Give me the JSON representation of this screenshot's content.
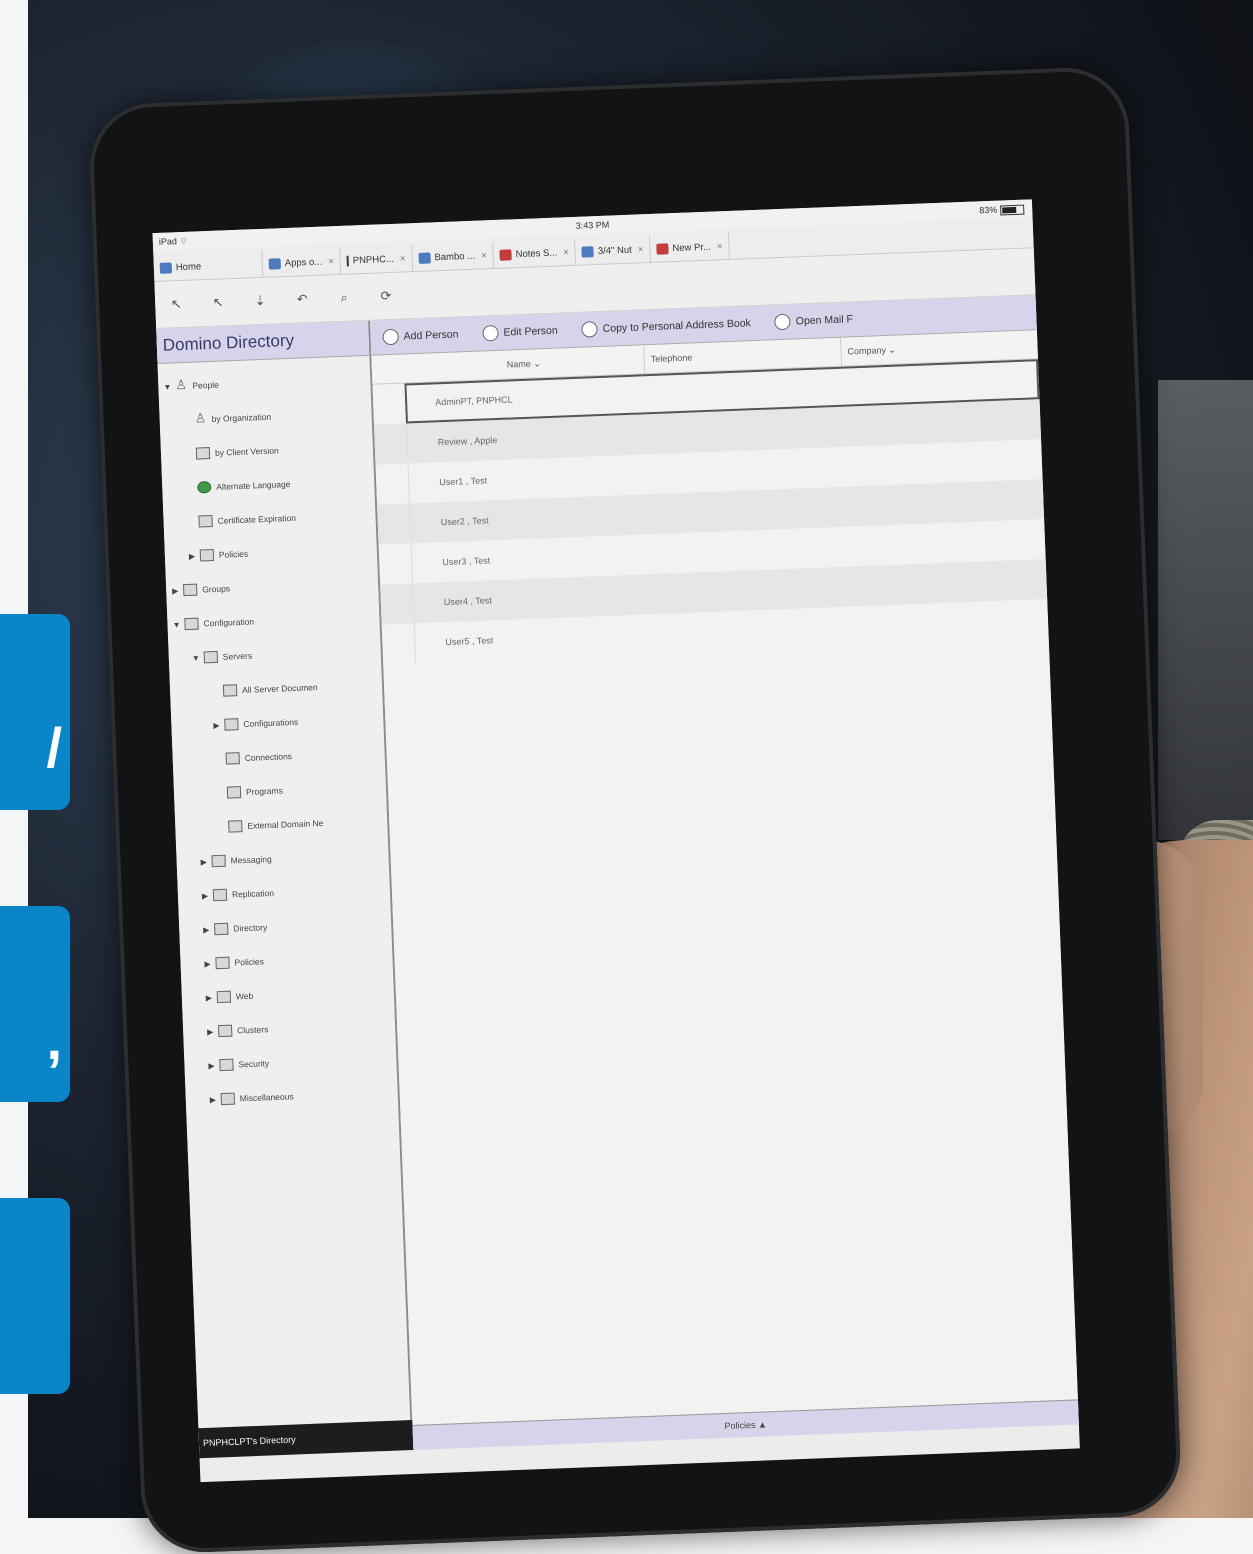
{
  "side_boxes": [
    {
      "glyph": "/"
    },
    {
      "glyph": ","
    },
    {
      "glyph": ""
    }
  ],
  "status_bar": {
    "device": "iPad",
    "wifi_icon": "wifi-icon",
    "time": "3:43 PM",
    "battery": "83%"
  },
  "tabs": [
    {
      "label": "Home",
      "icon": "home-icon",
      "closable": false
    },
    {
      "label": "Apps o...",
      "icon": "db-icon",
      "closable": true
    },
    {
      "label": "PNPHC...",
      "icon": "separator-icon",
      "closable": true
    },
    {
      "label": "Bambo ...",
      "icon": "db-icon",
      "closable": true
    },
    {
      "label": "Notes S...",
      "icon": "notes-icon",
      "closable": true
    },
    {
      "label": "3/4\" Nut",
      "icon": "db-icon",
      "closable": true
    },
    {
      "label": "New Pr...",
      "icon": "notes-icon",
      "closable": true
    }
  ],
  "toolbar": {
    "buttons": [
      "↖",
      "↖",
      "⇣",
      "↶",
      "⌕",
      "⟳"
    ]
  },
  "left_panel": {
    "title": "Domino Directory",
    "items": [
      {
        "label": "People",
        "arrow": "▼",
        "indent": 0,
        "icon": "person"
      },
      {
        "label": "by Organization",
        "arrow": "",
        "indent": 1,
        "icon": "person"
      },
      {
        "label": "by Client Version",
        "arrow": "",
        "indent": 1,
        "icon": "view"
      },
      {
        "label": "Alternate Language",
        "arrow": "",
        "indent": 1,
        "icon": "globe"
      },
      {
        "label": "Certificate Expiration",
        "arrow": "",
        "indent": 1,
        "icon": "view"
      },
      {
        "label": "Policies",
        "arrow": "▶",
        "indent": 1,
        "icon": "view"
      },
      {
        "label": "Groups",
        "arrow": "▶",
        "indent": 0,
        "icon": "view"
      },
      {
        "label": "Configuration",
        "arrow": "▼",
        "indent": 0,
        "icon": "view"
      },
      {
        "label": "Servers",
        "arrow": "▼",
        "indent": 1,
        "icon": "view"
      },
      {
        "label": "All Server Documen",
        "arrow": "",
        "indent": 2,
        "icon": "view"
      },
      {
        "label": "Configurations",
        "arrow": "▶",
        "indent": 2,
        "icon": "view"
      },
      {
        "label": "Connections",
        "arrow": "",
        "indent": 2,
        "icon": "view"
      },
      {
        "label": "Programs",
        "arrow": "",
        "indent": 2,
        "icon": "view"
      },
      {
        "label": "External Domain Ne",
        "arrow": "",
        "indent": 2,
        "icon": "view"
      },
      {
        "label": "Messaging",
        "arrow": "▶",
        "indent": 1,
        "icon": "view"
      },
      {
        "label": "Replication",
        "arrow": "▶",
        "indent": 1,
        "icon": "view"
      },
      {
        "label": "Directory",
        "arrow": "▶",
        "indent": 1,
        "icon": "view"
      },
      {
        "label": "Policies",
        "arrow": "▶",
        "indent": 1,
        "icon": "view"
      },
      {
        "label": "Web",
        "arrow": "▶",
        "indent": 1,
        "icon": "view"
      },
      {
        "label": "Clusters",
        "arrow": "▶",
        "indent": 1,
        "icon": "view"
      },
      {
        "label": "Security",
        "arrow": "▶",
        "indent": 1,
        "icon": "view"
      },
      {
        "label": "Miscellaneous",
        "arrow": "▶",
        "indent": 1,
        "icon": "view"
      }
    ],
    "footer": "PNPHCLPT's Directory"
  },
  "actions": [
    {
      "label": "Add Person",
      "icon": "add-icon"
    },
    {
      "label": "Edit Person",
      "icon": "edit-icon"
    },
    {
      "label": "Copy to Personal Address Book",
      "icon": "copy-icon"
    },
    {
      "label": "Open Mail F",
      "icon": "mail-icon"
    }
  ],
  "columns": [
    "Name ⌄",
    "Telephone",
    "Company ⌄"
  ],
  "rows": [
    {
      "name": "AdminPT, PNPHCL",
      "selected": true
    },
    {
      "name": "Review , Apple",
      "selected": false
    },
    {
      "name": "User1 , Test",
      "selected": false
    },
    {
      "name": "User2 , Test",
      "selected": false
    },
    {
      "name": "User3 , Test",
      "selected": false
    },
    {
      "name": "User4 , Test",
      "selected": false
    },
    {
      "name": "User5 , Test",
      "selected": false
    }
  ],
  "bottom_bar": "Policies ▲"
}
